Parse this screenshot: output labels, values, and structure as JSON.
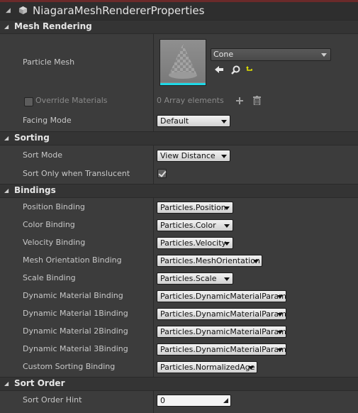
{
  "window": {
    "title": "NiagaraMeshRendererProperties"
  },
  "categories": {
    "mesh_rendering": "Mesh Rendering",
    "sorting": "Sorting",
    "bindings": "Bindings",
    "sort_order": "Sort Order"
  },
  "mesh_rendering": {
    "particle_mesh_label": "Particle Mesh",
    "particle_mesh_value": "Cone",
    "override_materials_label": "Override Materials",
    "array_elements": "0 Array elements",
    "facing_mode_label": "Facing Mode",
    "facing_mode_value": "Default"
  },
  "sorting": {
    "sort_mode_label": "Sort Mode",
    "sort_mode_value": "View Distance",
    "sort_translucent_label": "Sort Only when Translucent",
    "sort_translucent_checked": true
  },
  "bindings": [
    {
      "label": "Position Binding",
      "value": "Particles.Position"
    },
    {
      "label": "Color Binding",
      "value": "Particles.Color"
    },
    {
      "label": "Velocity Binding",
      "value": "Particles.Velocity"
    },
    {
      "label": "Mesh Orientation Binding",
      "value": "Particles.MeshOrientation"
    },
    {
      "label": "Scale Binding",
      "value": "Particles.Scale"
    },
    {
      "label": "Dynamic Material Binding",
      "value": "Particles.DynamicMaterialParam"
    },
    {
      "label": "Dynamic Material 1Binding",
      "value": "Particles.DynamicMaterialParam"
    },
    {
      "label": "Dynamic Material 2Binding",
      "value": "Particles.DynamicMaterialParam"
    },
    {
      "label": "Dynamic Material 3Binding",
      "value": "Particles.DynamicMaterialParam"
    },
    {
      "label": "Custom Sorting Binding",
      "value": "Particles.NormalizedAge"
    }
  ],
  "sort_order": {
    "hint_label": "Sort Order Hint",
    "hint_value": "0"
  },
  "colors": {
    "accent_cyan": "#1fd8e6",
    "title_line": "#6b2a2a"
  },
  "icons": [
    "cube-icon",
    "use-selected-arrow-icon",
    "browse-magnifier-icon",
    "reset-arrow-icon",
    "add-element-icon",
    "trash-icon"
  ]
}
